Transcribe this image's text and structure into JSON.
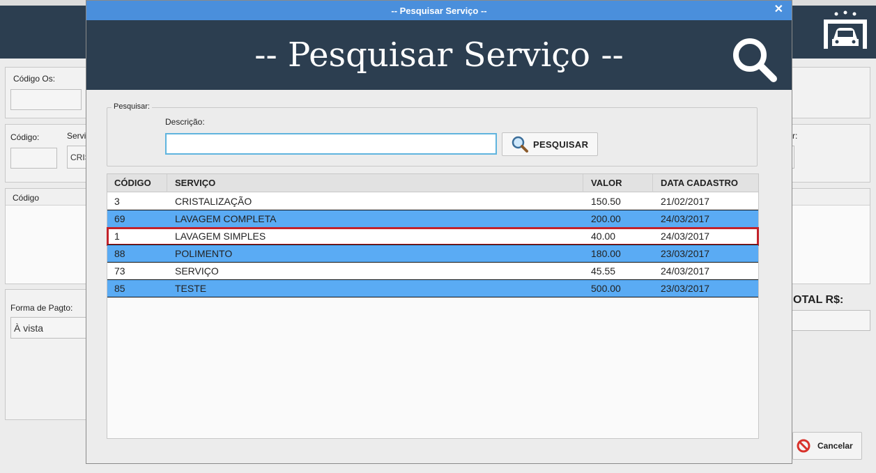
{
  "main": {
    "codigo_os_label": "Código Os:",
    "codigo_label": "Código:",
    "servico_label_partial": "Servi",
    "servico_value_partial": "CRIS",
    "right_label_partial": "r:",
    "grid_header_codigo": "Código",
    "forma_pagto_label": "Forma de Pagto:",
    "forma_pagto_value": "À vista",
    "total_label_partial": "OTAL R$:",
    "cancel_label": "Cancelar"
  },
  "modal": {
    "window_title": "-- Pesquisar Serviço --",
    "close_glyph": "✕",
    "heading": "-- Pesquisar Serviço --",
    "group_legend": "Pesquisar:",
    "descricao_label": "Descrição:",
    "descricao_value": "",
    "search_button_label": "PESQUISAR"
  },
  "table": {
    "columns": [
      "CÓDIGO",
      "SERVIÇO",
      "VALOR",
      "DATA CADASTRO"
    ],
    "rows": [
      {
        "codigo": "3",
        "servico": "CRISTALIZAÇÃO",
        "valor": "150.50",
        "data": "21/02/2017",
        "style": "white",
        "selected": false
      },
      {
        "codigo": "69",
        "servico": "LAVAGEM COMPLETA",
        "valor": "200.00",
        "data": "24/03/2017",
        "style": "blue",
        "selected": false
      },
      {
        "codigo": "1",
        "servico": "LAVAGEM SIMPLES",
        "valor": "40.00",
        "data": "24/03/2017",
        "style": "white",
        "selected": true
      },
      {
        "codigo": "88",
        "servico": "POLIMENTO",
        "valor": "180.00",
        "data": "23/03/2017",
        "style": "blue",
        "selected": false
      },
      {
        "codigo": "73",
        "servico": "SERVIÇO",
        "valor": "45.55",
        "data": "24/03/2017",
        "style": "white",
        "selected": false
      },
      {
        "codigo": "85",
        "servico": "TESTE",
        "valor": "500.00",
        "data": "23/03/2017",
        "style": "blue",
        "selected": false
      }
    ]
  },
  "icons": {
    "banner": "search-icon",
    "button": "magnifier-icon",
    "logo": "car-wash-icon",
    "cancel": "cancel-icon"
  },
  "colors": {
    "titlebar": "#4a8fdc",
    "banner": "#2c3e50",
    "row_blue": "#5aabf4",
    "selection": "#c2222a",
    "input_focus": "#5fb4de"
  }
}
